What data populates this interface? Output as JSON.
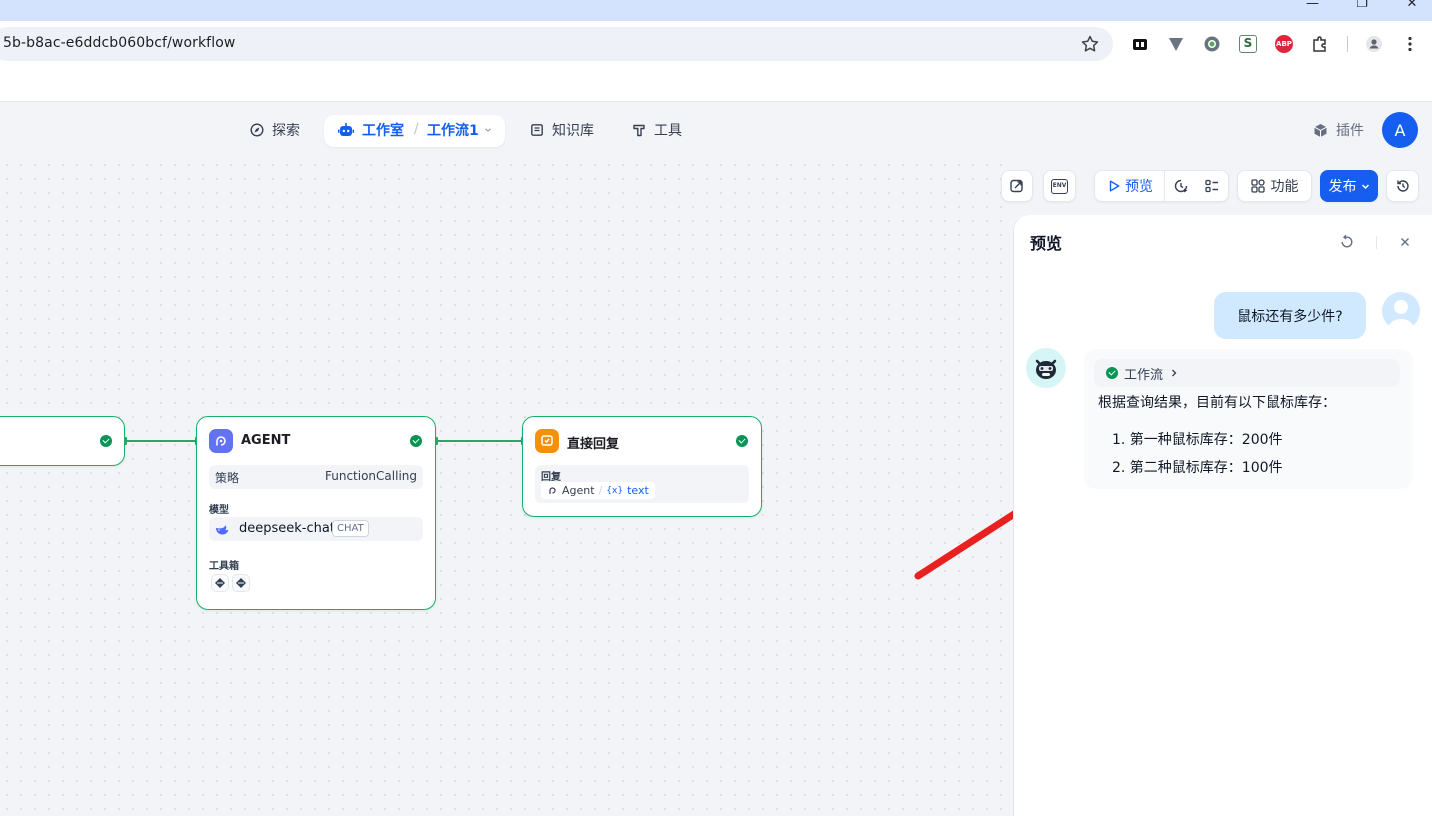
{
  "browser": {
    "url": "5b-b8ac-e6ddcb060bcf/workflow",
    "window_controls": [
      "minimize",
      "restore",
      "close"
    ],
    "extensions": [
      "tab-extension-icon",
      "vee-extension-icon",
      "circle-extension-icon",
      "s-extension-icon",
      "abp-extension-icon",
      "puzzle-extension-icon",
      "profile-icon",
      "menu-icon"
    ],
    "abp_label": "ABP",
    "s_label": "S"
  },
  "nav": {
    "explore": "探索",
    "studio": "工作室",
    "separator": "/",
    "workflow": "工作流1",
    "knowledge": "知识库",
    "tools": "工具",
    "plugins": "插件",
    "avatar_letter": "A"
  },
  "toolbar": {
    "env": "ENV",
    "preview": "预览",
    "features": "功能",
    "publish": "发布"
  },
  "nodes": {
    "agent": {
      "title": "AGENT",
      "strategy_label": "策略",
      "strategy_value": "FunctionCalling",
      "model_label": "模型",
      "model_value": "deepseek-chat",
      "model_badge": "CHAT",
      "tools_label": "工具箱"
    },
    "reply": {
      "title": "直接回复",
      "reply_label": "回复",
      "var_source": "Agent",
      "var_separator": "/",
      "var_icon": "{x}",
      "var_name": "text"
    }
  },
  "preview_panel": {
    "title": "预览",
    "user_message": "鼠标还有多少件?",
    "workflow_chip": "工作流",
    "answer_intro": "根据查询结果，目前有以下鼠标库存：",
    "answer_items": [
      "1. 第一种鼠标库存：200件",
      "2. 第二种鼠标库存：100件"
    ]
  },
  "colors": {
    "accent": "#155eef",
    "success": "#079455",
    "annotation_arrow": "#e8201f"
  }
}
